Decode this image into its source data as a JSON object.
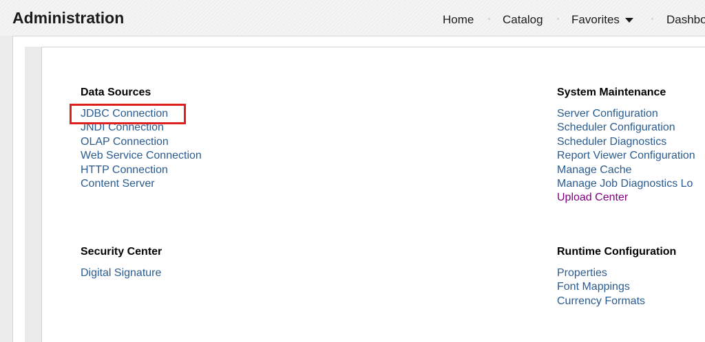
{
  "header": {
    "title": "Administration",
    "nav": {
      "home": "Home",
      "catalog": "Catalog",
      "favorites": "Favorites",
      "dashboards": "Dashbo"
    }
  },
  "sections": {
    "data_sources": {
      "title": "Data Sources",
      "links": [
        "JDBC Connection",
        "JNDI Connection",
        "OLAP Connection",
        "Web Service Connection",
        "HTTP Connection",
        "Content Server"
      ]
    },
    "system_maintenance": {
      "title": "System Maintenance",
      "links": [
        "Server Configuration",
        "Scheduler Configuration",
        "Scheduler Diagnostics",
        "Report Viewer Configuration",
        "Manage Cache",
        "Manage Job Diagnostics Lo",
        "Upload Center"
      ]
    },
    "security_center": {
      "title": "Security Center",
      "links": [
        "Digital Signature"
      ]
    },
    "runtime_configuration": {
      "title": "Runtime Configuration",
      "links": [
        "Properties",
        "Font Mappings",
        "Currency Formats"
      ]
    }
  },
  "colors": {
    "link": "#2a5b8f",
    "visited_link": "#800080",
    "highlight": "#e01e1e"
  }
}
